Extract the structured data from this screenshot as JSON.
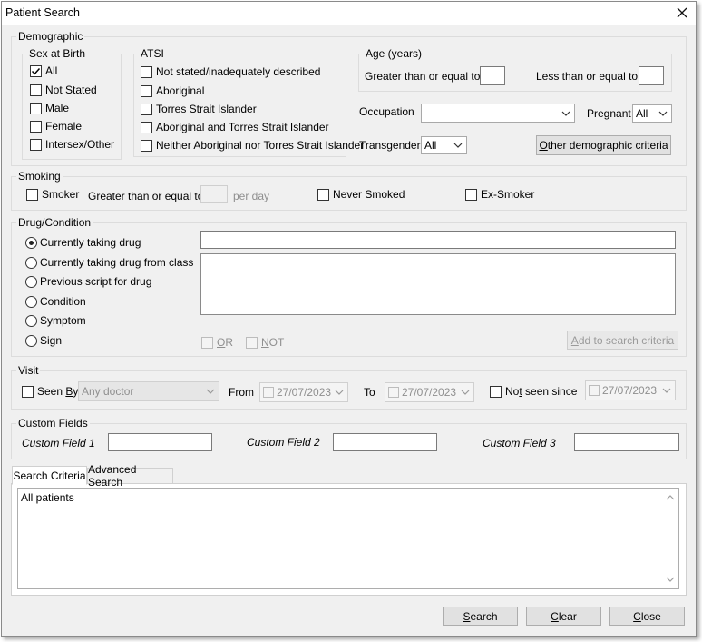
{
  "window": {
    "title": "Patient Search"
  },
  "demographic": {
    "legend": "Demographic",
    "sex_at_birth": {
      "legend": "Sex at Birth",
      "options": [
        {
          "label": "All",
          "checked": true
        },
        {
          "label": "Not Stated",
          "checked": false
        },
        {
          "label": "Male",
          "checked": false
        },
        {
          "label": "Female",
          "checked": false
        },
        {
          "label": "Intersex/Other",
          "checked": false
        }
      ]
    },
    "atsi": {
      "legend": "ATSI",
      "options": [
        {
          "label": "Not stated/inadequately described",
          "checked": false
        },
        {
          "label": "Aboriginal",
          "checked": false
        },
        {
          "label": "Torres Strait Islander",
          "checked": false
        },
        {
          "label": "Aboriginal and Torres Strait Islander",
          "checked": false
        },
        {
          "label": "Neither Aboriginal nor Torres Strait Islander",
          "checked": false
        }
      ]
    },
    "age": {
      "legend": "Age (years)",
      "gte_label": "Greater than or equal to:",
      "gte_value": "",
      "lte_label": "Less than or equal to:",
      "lte_value": ""
    },
    "occupation": {
      "label": "Occupation",
      "value": ""
    },
    "pregnant": {
      "label": "Pregnant",
      "value": "All"
    },
    "transgender": {
      "label": "Transgender",
      "value": "All"
    },
    "other_button": {
      "pre": "",
      "accel": "O",
      "post": "ther demographic criteria"
    }
  },
  "smoking": {
    "legend": "Smoking",
    "smoker_label": "Smoker",
    "smoker_checked": false,
    "gte_label": "Greater than or equal to",
    "gte_value": "",
    "per_day_label": "per day",
    "never_smoked_label": "Never Smoked",
    "never_smoked_checked": false,
    "ex_smoker_label": "Ex-Smoker",
    "ex_smoker_checked": false
  },
  "drug_condition": {
    "legend": "Drug/Condition",
    "options": [
      {
        "label": "Currently taking drug",
        "selected": true
      },
      {
        "label": "Currently taking drug from class",
        "selected": false
      },
      {
        "label": "Previous script for drug",
        "selected": false
      },
      {
        "label": "Condition",
        "selected": false
      },
      {
        "label": "Symptom",
        "selected": false
      },
      {
        "label": "Sign",
        "selected": false
      }
    ],
    "search_value": "",
    "or": {
      "pre": "",
      "accel": "O",
      "post": "R"
    },
    "not": {
      "pre": "",
      "accel": "N",
      "post": "OT"
    },
    "add_button": {
      "pre": "",
      "accel": "A",
      "post": "dd to search criteria"
    }
  },
  "visit": {
    "legend": "Visit",
    "seen_by": {
      "pre": "Seen ",
      "accel": "B",
      "post": "y"
    },
    "seen_by_checked": false,
    "doctor_value": "Any doctor",
    "from_label": "From",
    "from_date": "27/07/2023",
    "to_label": "To",
    "to_date": "27/07/2023",
    "not_seen": {
      "pre": "No",
      "accel": "t",
      "post": " seen since"
    },
    "not_seen_checked": false,
    "not_seen_date": "27/07/2023"
  },
  "custom_fields": {
    "legend": "Custom Fields",
    "fields": [
      {
        "label": "Custom Field 1",
        "value": ""
      },
      {
        "label": "Custom Field 2",
        "value": ""
      },
      {
        "label": "Custom Field 3",
        "value": ""
      }
    ]
  },
  "tabs": [
    {
      "label": "Search Criteria",
      "active": true
    },
    {
      "label": "Advanced Search",
      "active": false
    }
  ],
  "criteria_text": "All patients",
  "buttons": {
    "search": {
      "pre": "",
      "accel": "S",
      "post": "earch"
    },
    "clear": {
      "pre": "",
      "accel": "C",
      "post": "lear"
    },
    "close": {
      "pre": "",
      "accel": "C",
      "post": "lose"
    }
  },
  "icons": {
    "close": "close-icon",
    "check": "check-icon",
    "dropdown": "chevron-down-icon",
    "scroll_up": "chevron-up-icon",
    "scroll_down": "chevron-down-icon"
  }
}
